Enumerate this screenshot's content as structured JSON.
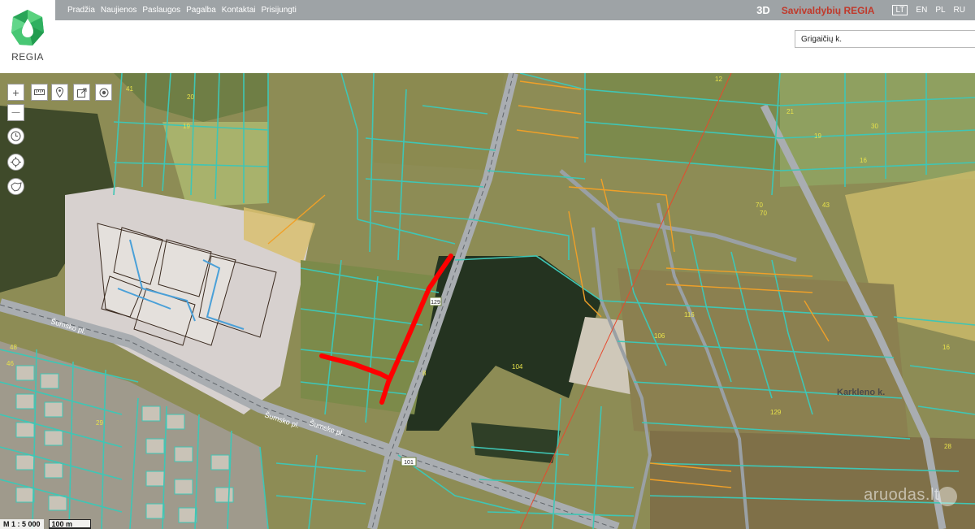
{
  "header": {
    "nav": [
      "Pradžia",
      "Naujienos",
      "Paslaugos",
      "Pagalba",
      "Kontaktai",
      "Prisijungti"
    ],
    "button_3d": "3D",
    "brand": "Savivaldybių REGIA",
    "languages": [
      "LT",
      "EN",
      "PL",
      "RU"
    ],
    "active_language": "LT",
    "logo_text": "REGIA",
    "search": {
      "value": "Grigaičių k.",
      "placeholder": ""
    }
  },
  "colors": {
    "header_bg": "#9ea3a6",
    "brand_red": "#c0392b",
    "parcel_line": "#3fc6b5",
    "parcel_line_orange": "#f0a028",
    "marked_route": "#ff0000",
    "road": "#a9adb1"
  },
  "toolbar": [
    {
      "icon": "zoom-in-icon",
      "glyph": "+"
    },
    {
      "icon": "zoom-out-icon",
      "glyph": "—"
    },
    {
      "icon": "measure-ruler-icon"
    },
    {
      "icon": "location-pin-icon"
    },
    {
      "icon": "share-export-icon"
    },
    {
      "icon": "gps-point-icon"
    },
    {
      "icon": "history-clock-icon"
    },
    {
      "icon": "crosshair-locate-icon"
    },
    {
      "icon": "lithuania-extent-icon"
    }
  ],
  "map": {
    "street_labels": [
      "Šumsko pl.",
      "Šumsko pl.",
      "Šumsko pl."
    ],
    "village_label": "Karkleno k.",
    "road_badges": [
      "129",
      "101"
    ],
    "parcel_numbers": [
      "41",
      "20",
      "8",
      "19",
      "116",
      "106",
      "104",
      "129",
      "28",
      "48",
      "46",
      "70",
      "43",
      "16",
      "21",
      "30",
      "70",
      "12",
      "16",
      "19",
      "29"
    ],
    "scale_ratio": "M 1 : 5 000",
    "scale_bar": "100 m",
    "watermark": "aruodas.lt"
  }
}
